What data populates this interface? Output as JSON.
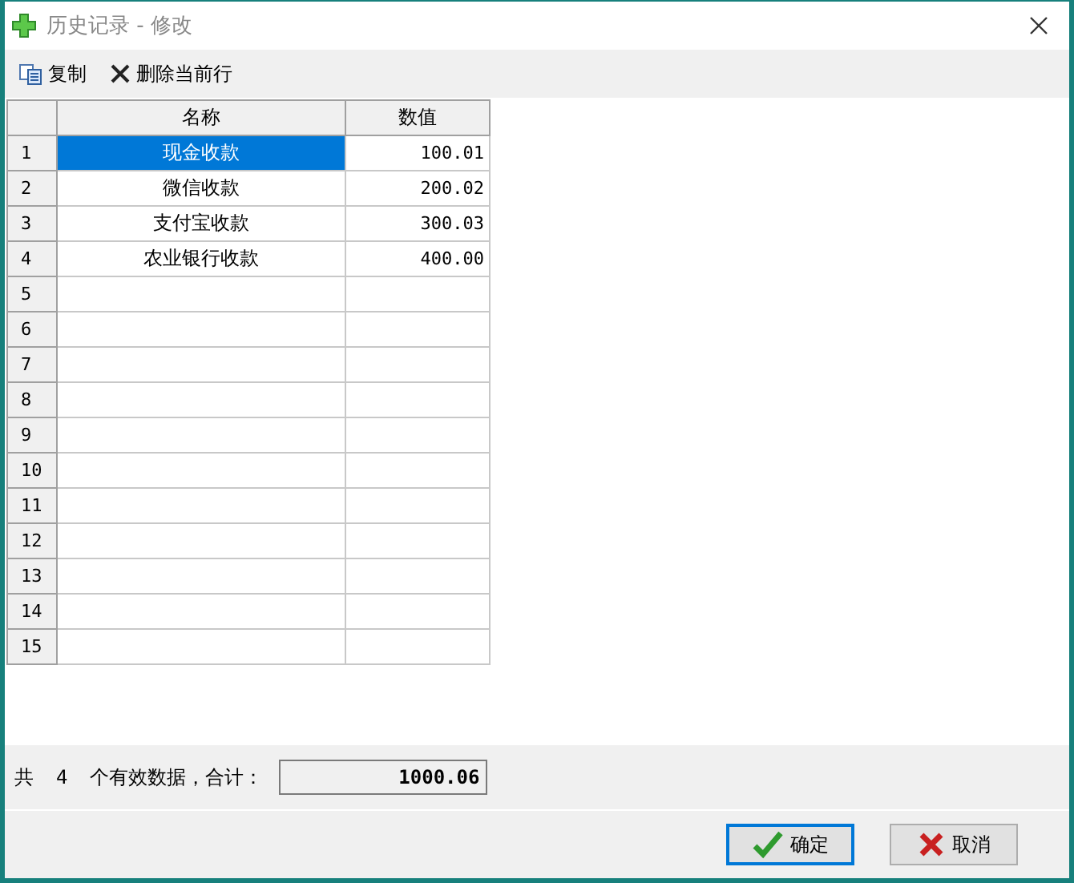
{
  "window": {
    "title": "历史记录 - 修改"
  },
  "toolbar": [
    {
      "label": "复制",
      "kind": "copy"
    },
    {
      "label": "删除当前行",
      "kind": "delete"
    }
  ],
  "table": {
    "columns": [
      "名称",
      "数值"
    ],
    "rows": [
      {
        "number": "1",
        "name": "现金收款",
        "value": "100.01",
        "selected": true
      },
      {
        "number": "2",
        "name": "微信收款",
        "value": "200.02",
        "selected": false
      },
      {
        "number": "3",
        "name": "支付宝收款",
        "value": "300.03",
        "selected": false
      },
      {
        "number": "4",
        "name": "农业银行收款",
        "value": "400.00",
        "selected": false
      },
      {
        "number": "5",
        "selected": false
      },
      {
        "number": "6",
        "selected": false
      },
      {
        "number": "7",
        "selected": false
      },
      {
        "number": "8",
        "selected": false
      },
      {
        "number": "9",
        "selected": false
      },
      {
        "number": "10",
        "selected": false
      },
      {
        "number": "11",
        "selected": false
      },
      {
        "number": "12",
        "selected": false
      },
      {
        "number": "13",
        "selected": false
      },
      {
        "number": "14",
        "selected": false
      },
      {
        "number": "15",
        "selected": false
      }
    ]
  },
  "summary": {
    "prefix": "共",
    "count": "4",
    "suffix": "个有效数据，合计：",
    "total": "1000.06"
  },
  "buttons": [
    {
      "label": "确定",
      "kind": "ok"
    },
    {
      "label": "取消",
      "kind": "cancel"
    }
  ]
}
